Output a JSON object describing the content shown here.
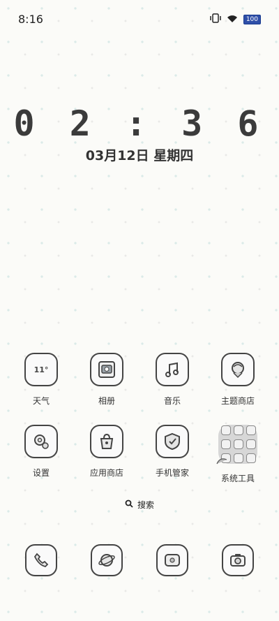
{
  "status": {
    "time": "8:16",
    "battery": "100",
    "icons": [
      "vibrate-icon",
      "wifi-icon",
      "battery-icon"
    ]
  },
  "clock": {
    "time": "0 2 : 3 6",
    "date": "03月12日 星期四"
  },
  "apps": [
    {
      "label": "天气",
      "icon": "weather-icon",
      "text": "11°"
    },
    {
      "label": "相册",
      "icon": "gallery-icon"
    },
    {
      "label": "音乐",
      "icon": "music-icon"
    },
    {
      "label": "主题商店",
      "icon": "theme-store-icon"
    },
    {
      "label": "设置",
      "icon": "settings-icon"
    },
    {
      "label": "应用商店",
      "icon": "app-store-icon"
    },
    {
      "label": "手机管家",
      "icon": "phone-manager-icon"
    },
    {
      "label": "系统工具",
      "icon": "folder-icon"
    }
  ],
  "search": {
    "label": "搜索"
  },
  "dock": [
    {
      "icon": "phone-icon"
    },
    {
      "icon": "browser-icon"
    },
    {
      "icon": "messages-icon"
    },
    {
      "icon": "camera-icon"
    }
  ],
  "colors": {
    "battery": "#2f4fa8",
    "outline": "#444444",
    "background": "#fbfbf8"
  }
}
